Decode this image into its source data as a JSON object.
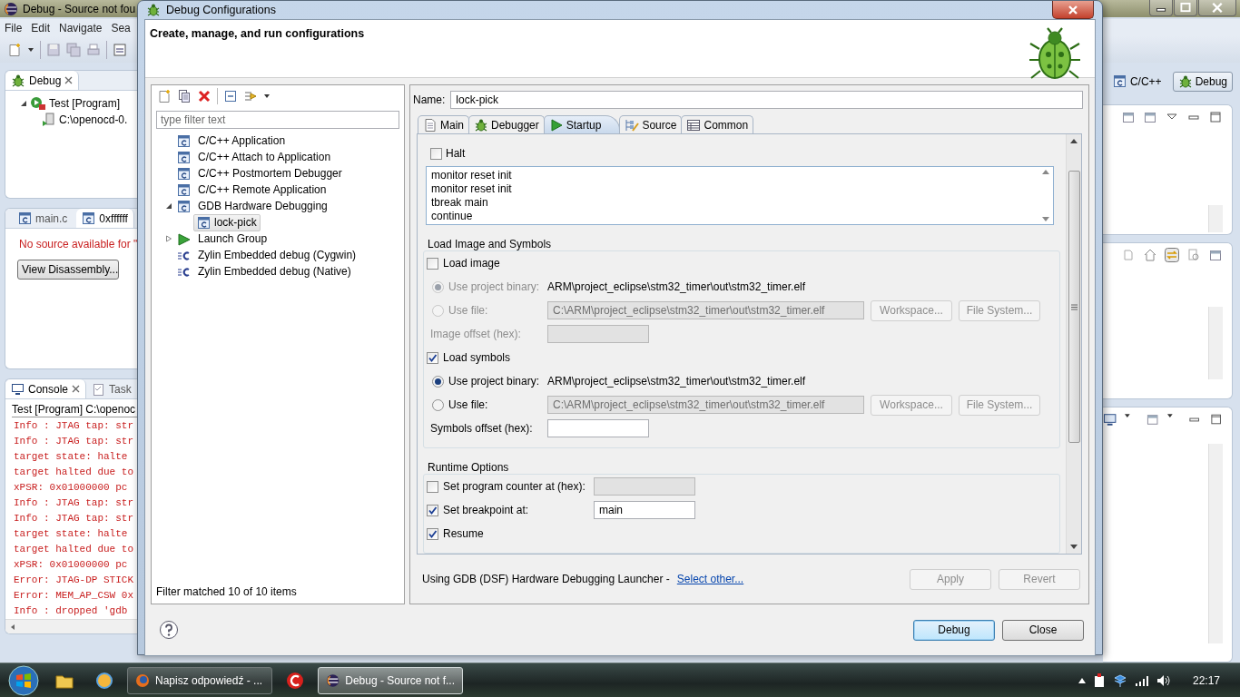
{
  "ide": {
    "title": "Debug - Source not fou",
    "menu": [
      "File",
      "Edit",
      "Navigate",
      "Sea"
    ],
    "debug_view": {
      "tab": "Debug",
      "tree": [
        {
          "label": "Test [Program]",
          "expanded": true,
          "children": [
            {
              "label": "C:\\openocd-0."
            }
          ]
        }
      ]
    },
    "editor_tabs": [
      {
        "label": "main.c",
        "selected": false
      },
      {
        "label": "0xffffff",
        "selected": true
      }
    ],
    "editor_message": "No source available for \"",
    "editor_button": "View Disassembly...",
    "console_tabs": [
      {
        "label": "Console",
        "selected": true
      },
      {
        "label": "Task",
        "selected": false
      }
    ],
    "console_process": "Test [Program] C:\\openoc",
    "console_lines": [
      "Info : JTAG tap: str",
      "Info : JTAG tap: str",
      "target state: halte",
      "target halted due to",
      "xPSR: 0x01000000 pc",
      "Info : JTAG tap: str",
      "Info : JTAG tap: str",
      "target state: halte",
      "target halted due to",
      "xPSR: 0x01000000 pc",
      "Error: JTAG-DP STICK",
      "Error: MEM_AP_CSW 0x",
      "Info : dropped 'gdb"
    ],
    "perspectives": [
      {
        "label": "C/C++",
        "selected": false
      },
      {
        "label": "Debug",
        "selected": true
      }
    ]
  },
  "dialog": {
    "title": "Debug Configurations",
    "header": "Create, manage, and run configurations",
    "filter": {
      "placeholder": "type filter text"
    },
    "config_tree": [
      {
        "label": "C/C++ Application",
        "kind": "c",
        "selected": false
      },
      {
        "label": "C/C++ Attach to Application",
        "kind": "c",
        "selected": false
      },
      {
        "label": "C/C++ Postmortem Debugger",
        "kind": "c",
        "selected": false
      },
      {
        "label": "C/C++ Remote Application",
        "kind": "c",
        "selected": false
      },
      {
        "label": "GDB Hardware Debugging",
        "kind": "c",
        "selected": false,
        "expanded": true,
        "children": [
          {
            "label": "lock-pick",
            "kind": "c",
            "selected": true
          }
        ]
      },
      {
        "label": "Launch Group",
        "kind": "launch",
        "selected": false,
        "expanded": false
      },
      {
        "label": "Zylin Embedded debug (Cygwin)",
        "kind": "zylin",
        "selected": false
      },
      {
        "label": "Zylin Embedded debug (Native)",
        "kind": "zylin",
        "selected": false
      }
    ],
    "filter_status": "Filter matched 10 of 10 items",
    "name": {
      "label": "Name:",
      "value": "lock-pick"
    },
    "tabs": [
      {
        "label": "Main",
        "selected": false
      },
      {
        "label": "Debugger",
        "selected": false
      },
      {
        "label": "Startup",
        "selected": true
      },
      {
        "label": "Source",
        "selected": false
      },
      {
        "label": "Common",
        "selected": false
      }
    ],
    "startup": {
      "halt": {
        "label": "Halt",
        "checked": false
      },
      "commands": [
        "monitor reset init",
        "monitor reset init",
        "tbreak main",
        "continue"
      ],
      "load_group": {
        "title": "Load Image and Symbols",
        "sections": [
          {
            "label": "Load image",
            "checked": false,
            "options": [
              {
                "label": "Use project binary:",
                "selected": true,
                "disabled": true,
                "value": "ARM\\project_eclipse\\stm32_timer\\out\\stm32_timer.elf"
              },
              {
                "label": "Use file:",
                "selected": false,
                "disabled": true,
                "value": "C:\\ARM\\project_eclipse\\stm32_timer\\out\\stm32_timer.elf",
                "buttons": [
                  "Workspace...",
                  "File System..."
                ]
              }
            ],
            "offset": {
              "label": "Image offset (hex):",
              "disabled": true
            }
          },
          {
            "label": "Load symbols",
            "checked": true,
            "options": [
              {
                "label": "Use project binary:",
                "selected": true,
                "disabled": false,
                "value": "ARM\\project_eclipse\\stm32_timer\\out\\stm32_timer.elf"
              },
              {
                "label": "Use file:",
                "selected": false,
                "disabled": false,
                "value": "C:\\ARM\\project_eclipse\\stm32_timer\\out\\stm32_timer.elf",
                "buttons": [
                  "Workspace...",
                  "File System..."
                ]
              }
            ],
            "offset": {
              "label": "Symbols offset (hex):",
              "disabled": false
            }
          }
        ]
      },
      "runtime": {
        "title": "Runtime Options",
        "rows": [
          {
            "label": "Set program counter at (hex):",
            "checked": false,
            "field": {
              "disabled": true
            }
          },
          {
            "label": "Set breakpoint at:",
            "checked": true,
            "field": {
              "value": "main",
              "disabled": false
            }
          },
          {
            "label": "Resume",
            "checked": true
          }
        ]
      }
    },
    "launcher": {
      "text": "Using GDB (DSF) Hardware Debugging Launcher -",
      "link": "Select other..."
    },
    "actions": [
      {
        "label": "Apply",
        "disabled": true
      },
      {
        "label": "Revert",
        "disabled": true
      }
    ],
    "buttons": [
      {
        "label": "Debug",
        "default": true
      },
      {
        "label": "Close",
        "default": false
      }
    ]
  },
  "taskbar": {
    "items": [
      {
        "kind": "pinned"
      },
      {
        "kind": "pinned"
      },
      {
        "kind": "window",
        "label": "Napisz odpowiedź - ...",
        "selected": false
      },
      {
        "kind": "pinned"
      },
      {
        "kind": "window",
        "label": "Debug - Source not f...",
        "selected": true
      }
    ],
    "clock": "22:17"
  }
}
